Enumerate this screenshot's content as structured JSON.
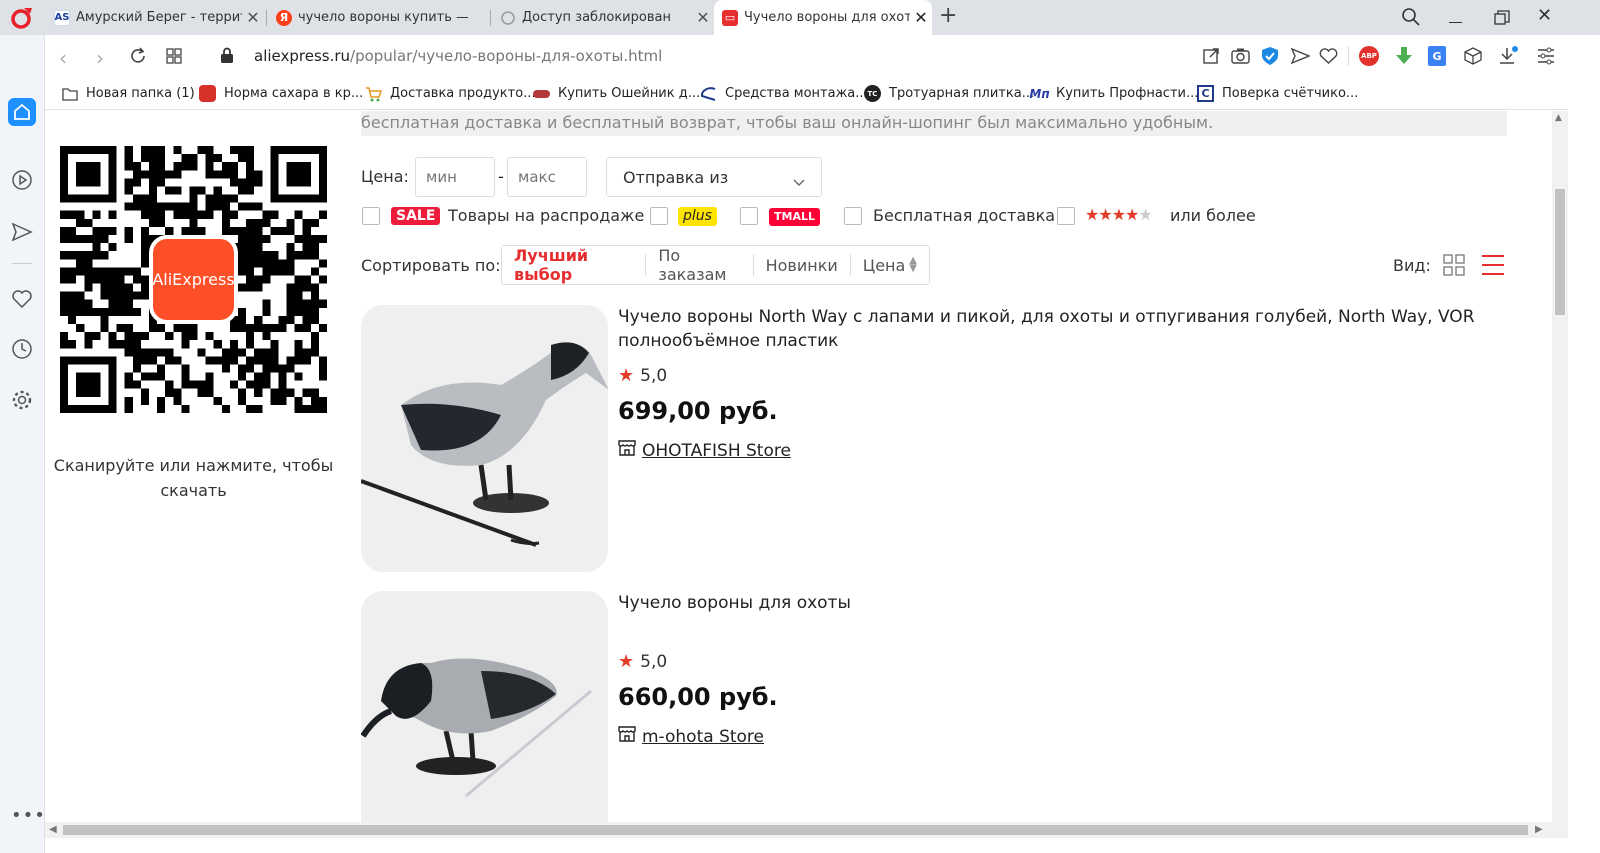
{
  "tabs": [
    {
      "title": "Амурский Берег - террито",
      "favicon": "as-logo",
      "active": false
    },
    {
      "title": "чучело вороны купить —",
      "favicon": "yandex-logo",
      "active": false
    },
    {
      "title": "Доступ заблокирован",
      "favicon": "loading-icon",
      "active": false
    },
    {
      "title": "Чучело вороны для охоты",
      "favicon": "aliexpress-logo",
      "active": true
    }
  ],
  "new_tab": "+",
  "address": {
    "domain": "aliexpress.ru",
    "path": "/popular/чучело-вороны-для-охоты.html"
  },
  "bookmarks": [
    {
      "label": "Новая папка (1)",
      "icon": "folder-icon"
    },
    {
      "label": "Норма сахара в кр...",
      "icon": "health-icon"
    },
    {
      "label": "Доставка продукто...",
      "icon": "cart-icon"
    },
    {
      "label": "Купить Ошейник д...",
      "icon": "collar-icon"
    },
    {
      "label": "Средства монтажа...",
      "icon": "mount-icon"
    },
    {
      "label": "Тротуарная плитка...",
      "icon": "tc-icon"
    },
    {
      "label": "Купить Профнасти...",
      "icon": "mp-icon"
    },
    {
      "label": "Поверка счётчико...",
      "icon": "c-icon"
    }
  ],
  "qr": {
    "brand": "AliExpress",
    "caption_line1": "Сканируйте или нажмите, чтобы",
    "caption_line2": "скачать"
  },
  "banner_text": "бесплатная доставка и бесплатный возврат, чтобы ваш онлайн-шопинг был максимально удобным.",
  "filters": {
    "price_label": "Цена:",
    "min_placeholder": "мин",
    "dash": "-",
    "max_placeholder": "макс",
    "ship_from": "Отправка из",
    "sale_badge": "SALE",
    "sale_label": "Товары на распродаже",
    "plus_badge": "plus",
    "tmall_badge": "TMALL",
    "free_delivery": "Бесплатная доставка",
    "stars_filled": 4,
    "or_more": "или более"
  },
  "sort": {
    "label": "Сортировать по:",
    "options": [
      "Лучший выбор",
      "По заказам",
      "Новинки",
      "Цена"
    ],
    "active": "Лучший выбор",
    "view_label": "Вид:"
  },
  "products": [
    {
      "title_line1": "Чучело вороны North Way с лапами и пикой, для охоты и отпугивания голубей, North Way, VOR",
      "title_line2": "полнообъёмное пластик",
      "rating": "5,0",
      "price": "699,00 руб.",
      "store": "OHOTAFISH Store"
    },
    {
      "title_line1": "Чучело вороны для охоты",
      "title_line2": "",
      "rating": "5,0",
      "price": "660,00 руб.",
      "store": "m-ohota Store"
    }
  ],
  "colors": {
    "accent": "#e62e2e",
    "sale": "#ed1c3a",
    "plus": "#ffe400",
    "tmall": "#ff0036",
    "star": "#e23d28"
  }
}
